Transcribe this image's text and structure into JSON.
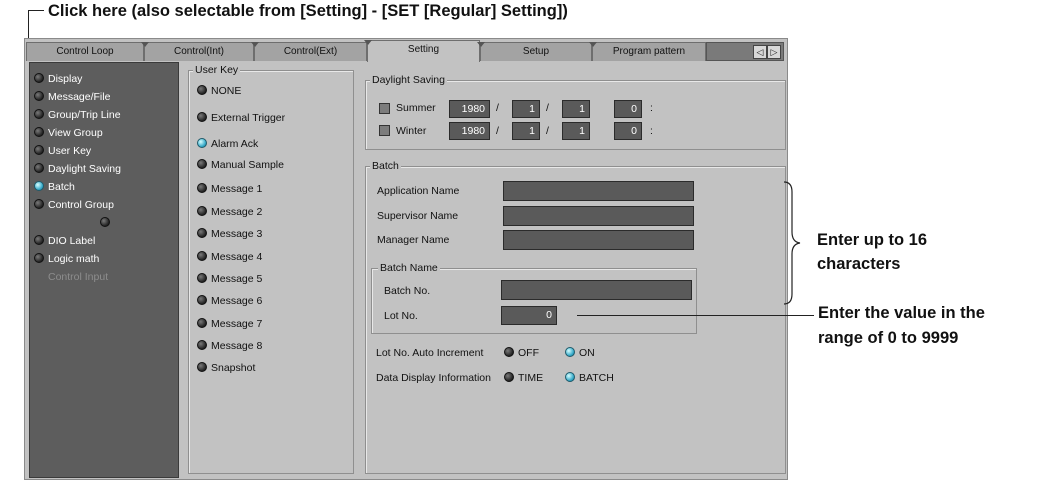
{
  "annotations": {
    "top": "Click here (also selectable from [Setting] - [SET [Regular] Setting])",
    "enter_16_line1": "Enter up to 16",
    "enter_16_line2": "characters",
    "range_line1": "Enter the value in the",
    "range_line2": "range of 0 to 9999"
  },
  "tabs": [
    {
      "label": "Control Loop",
      "active": false
    },
    {
      "label": "Control(Int)",
      "active": false
    },
    {
      "label": "Control(Ext)",
      "active": false
    },
    {
      "label": "Setting",
      "active": true
    },
    {
      "label": "Setup",
      "active": false
    },
    {
      "label": "Program pattern",
      "active": false
    }
  ],
  "tab_arrows": {
    "left": "◁",
    "right": "▷"
  },
  "sidebar": {
    "items": [
      {
        "label": "Display",
        "selected": false
      },
      {
        "label": "Message/File",
        "selected": false
      },
      {
        "label": "Group/Trip Line",
        "selected": false
      },
      {
        "label": "View Group",
        "selected": false
      },
      {
        "label": "User Key",
        "selected": false
      },
      {
        "label": "Daylight Saving",
        "selected": false
      },
      {
        "label": "Batch",
        "selected": true
      },
      {
        "label": "Control Group",
        "selected": false
      },
      {
        "label": "DIO Label",
        "selected": false
      },
      {
        "label": "Logic math",
        "selected": false
      }
    ],
    "disabled_item": "Control Input"
  },
  "user_key": {
    "title": "User Key",
    "options": [
      {
        "label": "NONE",
        "selected": false
      },
      {
        "label": "External Trigger",
        "selected": false
      },
      {
        "label": "Alarm Ack",
        "selected": true
      },
      {
        "label": "Manual Sample",
        "selected": false
      },
      {
        "label": "Message 1",
        "selected": false
      },
      {
        "label": "Message 2",
        "selected": false
      },
      {
        "label": "Message 3",
        "selected": false
      },
      {
        "label": "Message 4",
        "selected": false
      },
      {
        "label": "Message 5",
        "selected": false
      },
      {
        "label": "Message 6",
        "selected": false
      },
      {
        "label": "Message 7",
        "selected": false
      },
      {
        "label": "Message 8",
        "selected": false
      },
      {
        "label": "Snapshot",
        "selected": false
      }
    ]
  },
  "daylight_saving": {
    "title": "Daylight Saving",
    "summer": {
      "label": "Summer",
      "year": "1980",
      "month": "1",
      "day": "1",
      "hour": "0"
    },
    "winter": {
      "label": "Winter",
      "year": "1980",
      "month": "1",
      "day": "1",
      "hour": "0"
    },
    "sep_slash": "/",
    "sep_colon": ":"
  },
  "batch": {
    "title": "Batch",
    "application_name_label": "Application Name",
    "supervisor_name_label": "Supervisor Name",
    "manager_name_label": "Manager Name",
    "application_name": "",
    "supervisor_name": "",
    "manager_name": "",
    "batch_name": {
      "title": "Batch Name",
      "batch_no_label": "Batch No.",
      "batch_no": "",
      "lot_no_label": "Lot No.",
      "lot_no": "0"
    },
    "lot_auto_increment": {
      "label": "Lot No. Auto Increment",
      "off": "OFF",
      "on": "ON",
      "value": "ON"
    },
    "data_display_info": {
      "label": "Data Display Information",
      "time": "TIME",
      "batch": "BATCH",
      "value": "BATCH"
    }
  },
  "colors": {
    "selected_radio": "#33a8c8",
    "panel": "#c2c2c2",
    "sidebar": "#5d5d5d"
  }
}
